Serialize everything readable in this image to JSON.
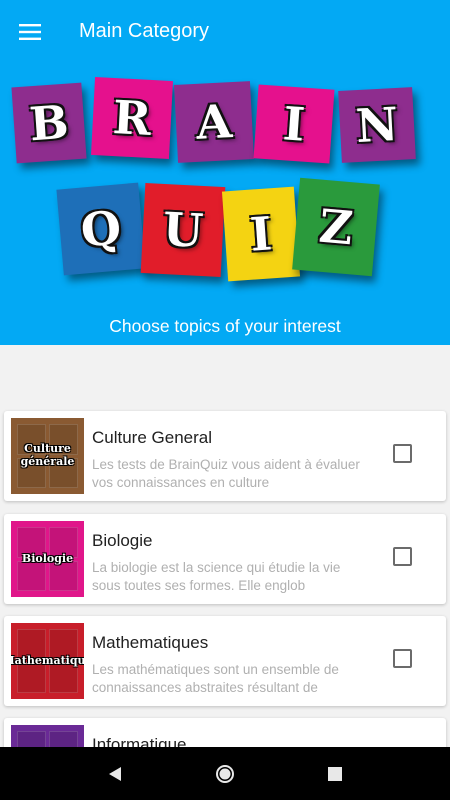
{
  "app_bar": {
    "title": "Main Category",
    "menu_icon": "hamburger-menu-icon"
  },
  "banner": {
    "logo_row1": [
      "B",
      "R",
      "A",
      "I",
      "N"
    ],
    "logo_row2": [
      "Q",
      "U",
      "I",
      "Z"
    ],
    "row1_colors": [
      "#8e2d8e",
      "#e5118d",
      "#8e2d8e",
      "#e5118d",
      "#8e2d8e"
    ],
    "row2_colors": [
      "#1e6fb8",
      "#e11d2a",
      "#f4d312",
      "#2a9a3c"
    ],
    "subtitle": "Choose topics of your interest"
  },
  "categories": [
    {
      "title": "Culture General",
      "description": "Les tests de BrainQuiz vous aident à évaluer vos connaissances en culture",
      "thumb_label": "Culture générale",
      "thumb_color": "#8a5a32",
      "checked": false
    },
    {
      "title": "Biologie",
      "description": "La biologie est la science qui étudie la vie sous toutes ses formes. Elle englob",
      "thumb_label": "Biologie",
      "thumb_color": "#e0168a",
      "checked": false
    },
    {
      "title": "Mathematiques",
      "description": "Les mathématiques sont un ensemble de connaissances abstraites résultant de",
      "thumb_label": "Mathematique",
      "thumb_color": "#c81e2a",
      "checked": false
    },
    {
      "title": "Informatique",
      "description": "",
      "thumb_label": "",
      "thumb_color": "#6a2a96",
      "checked": false
    }
  ],
  "nav_bar": {
    "back_icon": "back-triangle-icon",
    "home_icon": "home-circle-icon",
    "recents_icon": "recents-square-icon"
  }
}
